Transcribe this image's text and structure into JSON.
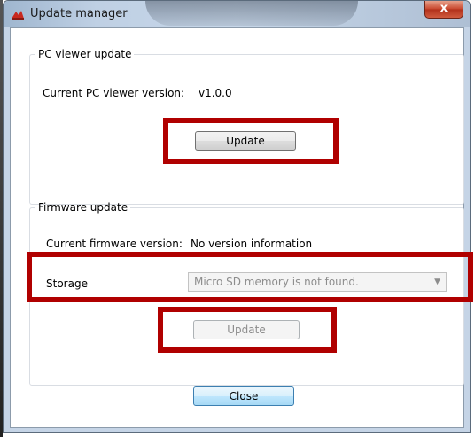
{
  "window": {
    "title": "Update manager",
    "close_glyph": "x",
    "icon": "app-logo-icon"
  },
  "pc_viewer": {
    "legend": "PC viewer update",
    "version_label": "Current PC viewer version:",
    "version_value": "v1.0.0",
    "update_label": "Update"
  },
  "firmware": {
    "legend": "Firmware update",
    "version_label": "Current firmware version:",
    "version_value": "No version information",
    "storage_label": "Storage",
    "storage_value": "Micro SD memory is not found.",
    "update_label": "Update"
  },
  "footer": {
    "close_label": "Close"
  },
  "colors": {
    "highlight": "#b00000",
    "title_gradient": "#c6d6e8"
  }
}
